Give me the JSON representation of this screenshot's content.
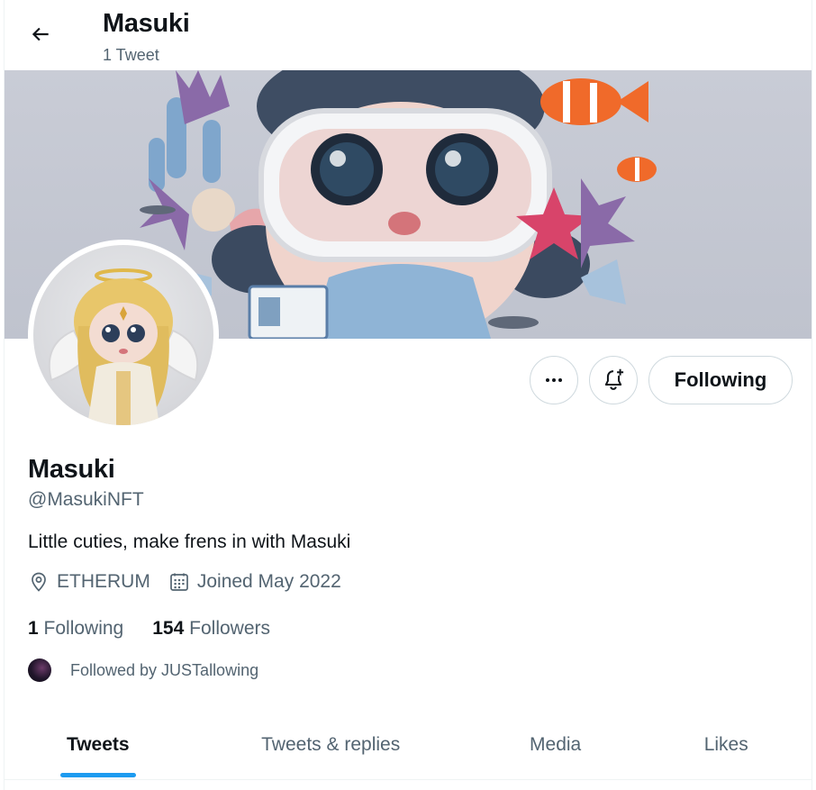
{
  "header": {
    "title": "Masuki",
    "tweet_count": "1 Tweet",
    "back_icon": "arrow-left-icon"
  },
  "profile": {
    "display_name": "Masuki",
    "handle": "@MasukiNFT",
    "bio": "Little cuties, make frens in with Masuki",
    "location": "ETHERUM",
    "joined": "Joined May 2022",
    "following_count": "1",
    "following_label": "Following",
    "followers_count": "154",
    "followers_label": "Followers",
    "followed_by": "Followed by JUSTallowing"
  },
  "actions": {
    "more_icon": "more-horizontal-icon",
    "notify_icon": "bell-plus-icon",
    "following_button": "Following"
  },
  "tabs": [
    {
      "label": "Tweets",
      "active": true
    },
    {
      "label": "Tweets & replies",
      "active": false
    },
    {
      "label": "Media",
      "active": false
    },
    {
      "label": "Likes",
      "active": false
    }
  ],
  "colors": {
    "accent": "#1d9bf0",
    "text_primary": "#0f1419",
    "text_secondary": "#536471",
    "border": "#cfd9de"
  }
}
